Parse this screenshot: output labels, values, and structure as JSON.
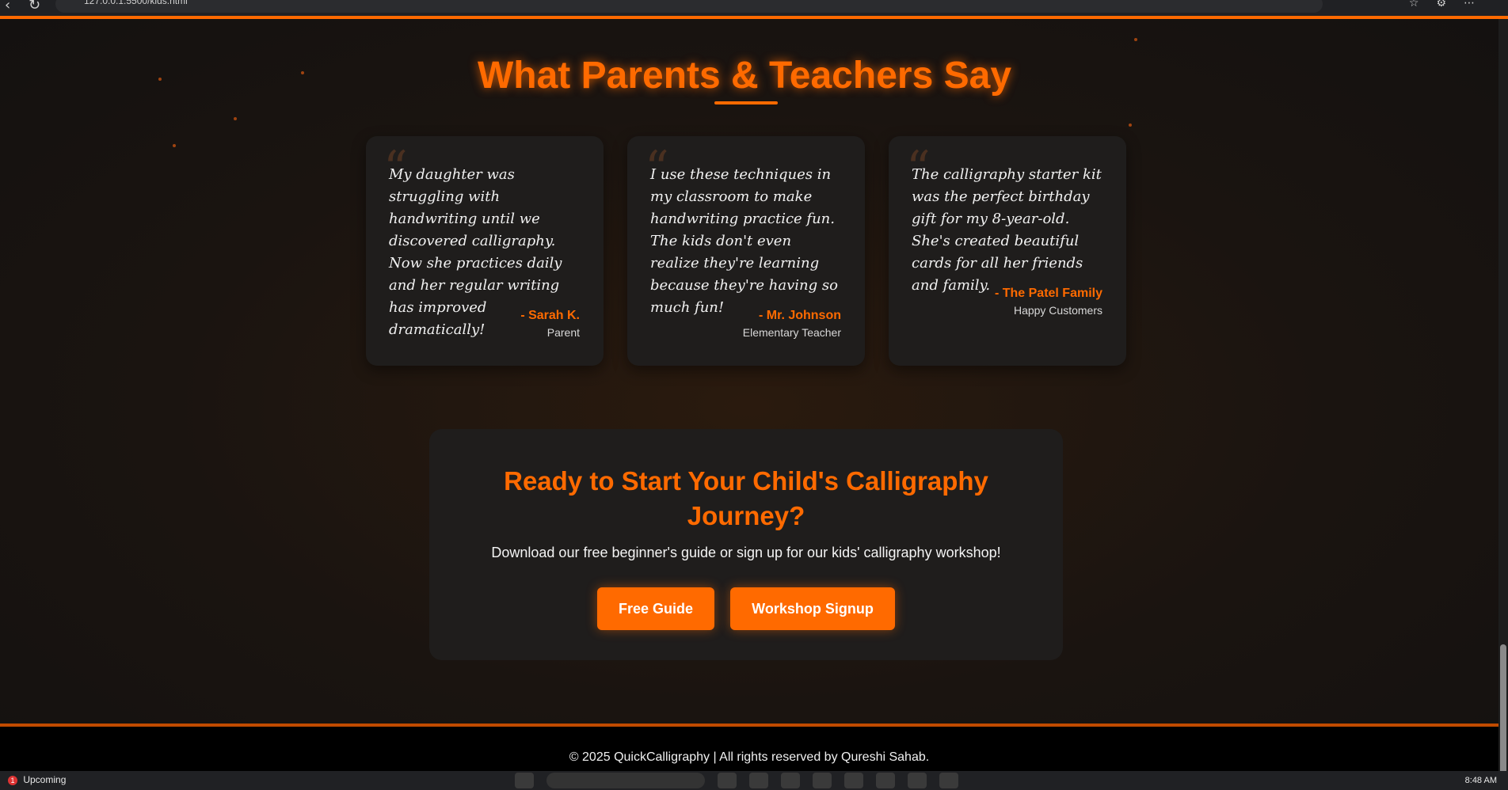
{
  "browser": {
    "url": "127.0.0.1:5500/kids.html"
  },
  "testimonials": {
    "title": "What Parents & Teachers Say",
    "cards": [
      {
        "quote": "My daughter was struggling with handwriting until we discovered calligraphy. Now she practices daily and her regular writing has improved dramatically!",
        "author": "- Sarah K.",
        "role": "Parent"
      },
      {
        "quote": "I use these techniques in my classroom to make handwriting practice fun. The kids don't even realize they're learning because they're having so much fun!",
        "author": "- Mr. Johnson",
        "role": "Elementary Teacher"
      },
      {
        "quote": "The calligraphy starter kit was the perfect birthday gift for my 8-year-old. She's created beautiful cards for all her friends and family.",
        "author": "- The Patel Family",
        "role": "Happy Customers"
      }
    ]
  },
  "cta": {
    "title": "Ready to Start Your Child's Calligraphy Journey?",
    "text": "Download our free beginner's guide or sign up for our kids' calligraphy workshop!",
    "button_guide": "Free Guide",
    "button_signup": "Workshop Signup"
  },
  "footer": {
    "text": "© 2025 QuickCalligraphy | All rights reserved by Qureshi Sahab."
  },
  "taskbar": {
    "notification_count": "1",
    "widget_label": "Upcoming",
    "time": "8:48 AM"
  },
  "colors": {
    "accent": "#ff6a00",
    "background": "#171310",
    "card": "#1f1d1c"
  }
}
